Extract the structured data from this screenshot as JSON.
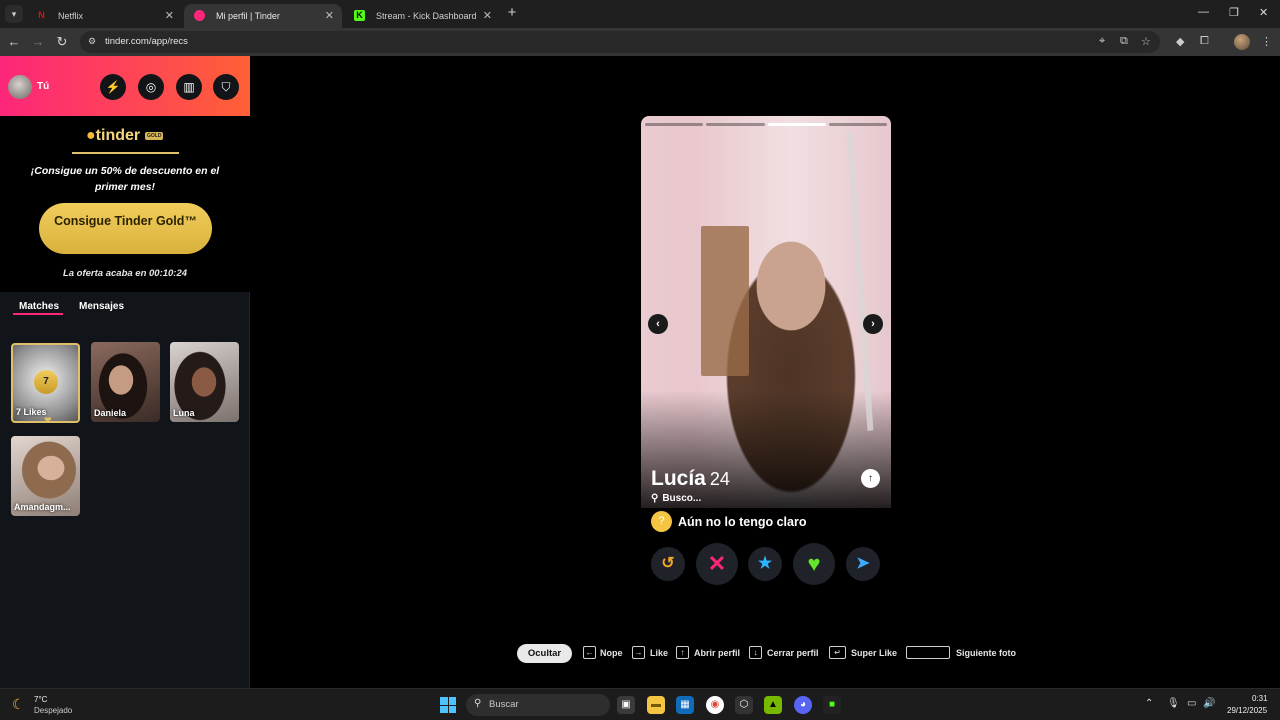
{
  "browser": {
    "tabs": [
      {
        "title": "Netflix",
        "favicon_color": "#e50914"
      },
      {
        "title": "Mi perfil | Tinder",
        "favicon_color": "#fd267a"
      },
      {
        "title": "Stream - Kick Dashboard",
        "favicon_color": "#53fc18"
      }
    ],
    "url": "tinder.com/app/recs"
  },
  "sidebar": {
    "user_label": "Tú",
    "gold_logo": "tinder",
    "gold_badge": "GOLD",
    "promo_text": "¡Consigue un 50% de descuento en el primer mes!",
    "cta_label": "Consigue Tinder Gold™",
    "offer_text": "La oferta acaba en 00:10:24",
    "tabs": [
      "Matches",
      "Mensajes"
    ],
    "likes": {
      "count": "7",
      "label": "7 Likes"
    },
    "matches": [
      {
        "name": "Daniela"
      },
      {
        "name": "Luna"
      },
      {
        "name": "Amandagm..."
      }
    ]
  },
  "card": {
    "name": "Lucía",
    "age": "24",
    "looking_label": "Busco...",
    "intent": "Aún no lo tengo claro",
    "photo_count": 4,
    "active_photo": 3
  },
  "hints": {
    "hide": "Ocultar",
    "nope": "Nope",
    "like": "Like",
    "open_profile": "Abrir perfil",
    "close_profile": "Cerrar perfil",
    "super_like": "Super Like",
    "next_photo": "Siguiente foto"
  },
  "taskbar": {
    "temp": "7°C",
    "weather": "Despejado",
    "search_placeholder": "Buscar",
    "time": "0:31",
    "date": "29/12/2025"
  },
  "colors": {
    "tinder_gradient_start": "#fd267a",
    "tinder_gradient_end": "#ff6036",
    "gold": "#e0bf6b"
  }
}
